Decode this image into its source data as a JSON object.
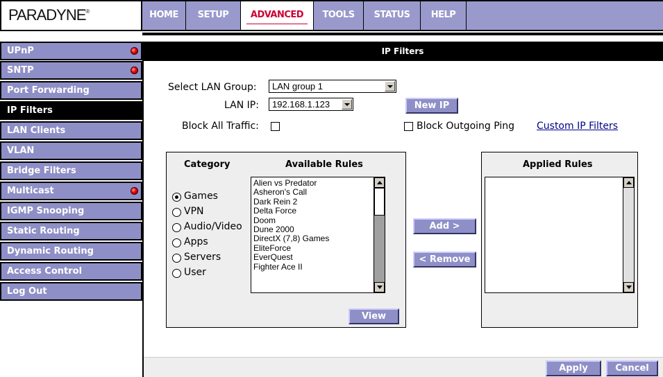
{
  "brand": {
    "logo": "PARADYNE",
    "trademark": "®"
  },
  "topnav": {
    "tabs": [
      {
        "label": "HOME"
      },
      {
        "label": "SETUP"
      },
      {
        "label": "ADVANCED"
      },
      {
        "label": "TOOLS"
      },
      {
        "label": "STATUS"
      },
      {
        "label": "HELP"
      }
    ],
    "active_tab": "ADVANCED"
  },
  "sidebar": {
    "items": [
      {
        "label": "UPnP",
        "status_dot": "red-dot-icon"
      },
      {
        "label": "SNTP",
        "status_dot": "red-dot-icon"
      },
      {
        "label": "Port Forwarding"
      },
      {
        "label": "IP Filters"
      },
      {
        "label": "LAN Clients"
      },
      {
        "label": "VLAN"
      },
      {
        "label": "Bridge Filters"
      },
      {
        "label": "Multicast",
        "status_dot": "red-dot-icon"
      },
      {
        "label": "IGMP Snooping"
      },
      {
        "label": "Static Routing"
      },
      {
        "label": "Dynamic Routing"
      },
      {
        "label": "Access Control"
      },
      {
        "label": "Log Out"
      }
    ],
    "active_item": "IP Filters"
  },
  "page": {
    "title": "IP Filters",
    "select_lan_group": {
      "label": "Select LAN Group:",
      "value": "LAN group 1"
    },
    "lan_ip": {
      "label": "LAN IP:",
      "value": "192.168.1.123"
    },
    "new_ip_button": "New IP",
    "block_all_traffic": {
      "label": "Block All Traffic:",
      "checked": false
    },
    "block_outgoing_ping": {
      "label": "Block Outgoing Ping",
      "checked": false
    },
    "custom_ip_filters_link": "Custom IP Filters"
  },
  "rules_panel": {
    "category_header": "Category",
    "available_rules_header": "Available Rules",
    "categories": [
      {
        "label": "Games",
        "selected": true
      },
      {
        "label": "VPN",
        "selected": false
      },
      {
        "label": "Audio/Video",
        "selected": false
      },
      {
        "label": "Apps",
        "selected": false
      },
      {
        "label": "Servers",
        "selected": false
      },
      {
        "label": "User",
        "selected": false
      }
    ],
    "available_rules": [
      "Alien vs Predator",
      "Asheron's Call",
      "Dark Rein 2",
      "Delta Force",
      "Doom",
      "Dune 2000",
      "DirectX (7,8) Games",
      "EliteForce",
      "EverQuest",
      "Fighter Ace II"
    ],
    "view_button": "View"
  },
  "transfer": {
    "add_button": "Add >",
    "remove_button": "< Remove"
  },
  "applied_panel": {
    "header": "Applied Rules",
    "rules": []
  },
  "footer": {
    "apply_button": "Apply",
    "cancel_button": "Cancel"
  },
  "colors": {
    "nav_purple": "#8f8fc7",
    "active_tab_text": "#cc0033",
    "status_dot": "#ee0000"
  }
}
